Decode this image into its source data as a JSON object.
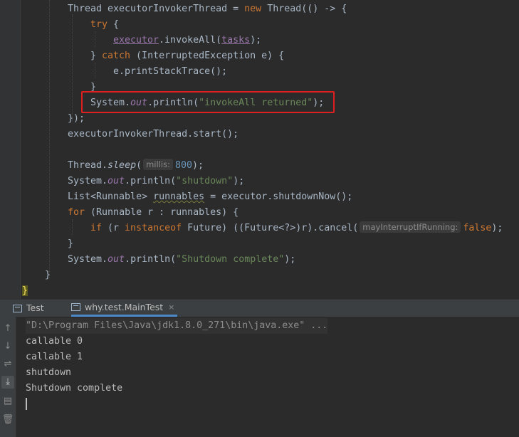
{
  "editor": {
    "lines": {
      "l1": {
        "a": "Thread executorInvokerThread = ",
        "b": "new",
        "c": " Thread(() -> {"
      },
      "l2": {
        "a": "try",
        "b": " {"
      },
      "l3": {
        "a": "executor",
        "b": ".invokeAll(",
        "c": "tasks",
        "d": ");"
      },
      "l4": {
        "a": "} ",
        "b": "catch",
        "c": " (InterruptedException e) {"
      },
      "l5": {
        "a": "e.printStackTrace();"
      },
      "l6": {
        "a": "}"
      },
      "l7": {
        "a": "System.",
        "b": "out",
        "c": ".println(",
        "d": "\"invokeAll returned\"",
        "e": ");"
      },
      "l8": {
        "a": "});"
      },
      "l9": {
        "a": "executorInvokerThread.start();"
      },
      "l10": {
        "a": "Thread.",
        "b": "sleep",
        "c": "(",
        "hint": "millis:",
        "d": "800",
        "e": ");"
      },
      "l11": {
        "a": "System.",
        "b": "out",
        "c": ".println(",
        "d": "\"shutdown\"",
        "e": ");"
      },
      "l12": {
        "a": "List<Runnable> ",
        "b": "runnables",
        "c": " = executor.shutdownNow();"
      },
      "l13": {
        "a": "for",
        "b": " (Runnable r : runnables) {"
      },
      "l14": {
        "a": "if",
        "b": " (r ",
        "c": "instanceof",
        "d": " Future) ((Future<?>)r).cancel(",
        "hint": "mayInterruptIfRunning:",
        "e": "false",
        "f": ");"
      },
      "l15": {
        "a": "}"
      },
      "l16": {
        "a": "System.",
        "b": "out",
        "c": ".println(",
        "d": "\"Shutdown complete\"",
        "e": ");"
      },
      "l17": {
        "a": "}"
      },
      "l18": {
        "a": "}"
      }
    }
  },
  "run_panel": {
    "tabs": [
      {
        "label": "Test"
      },
      {
        "label": "why.test.MainTest",
        "close": "×"
      }
    ]
  },
  "console": {
    "lines": [
      "\"D:\\Program Files\\Java\\jdk1.8.0_271\\bin\\java.exe\" ...",
      "callable 0",
      "callable 1",
      "shutdown",
      "Shutdown complete"
    ]
  },
  "toolbar_icons": [
    "arrow-up-icon",
    "arrow-down-icon",
    "soft-wrap-icon",
    "scroll-to-end-icon",
    "print-icon",
    "trash-icon"
  ],
  "colors": {
    "highlight_box": "#e02020",
    "keyword": "#cc7832",
    "string": "#6a8759",
    "number": "#6897bb",
    "field": "#9876aa"
  }
}
